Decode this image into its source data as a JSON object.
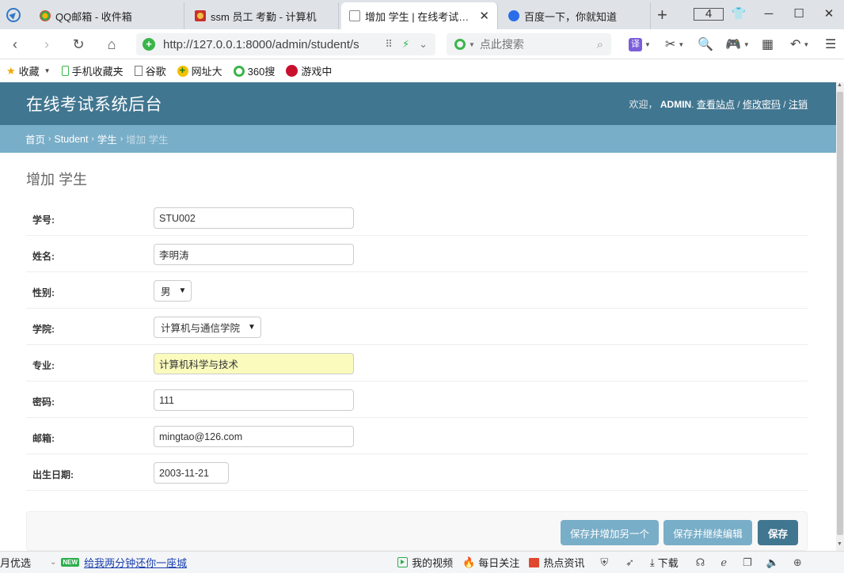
{
  "browser": {
    "tabs": [
      {
        "title": "QQ邮箱 - 收件箱",
        "active": false
      },
      {
        "title": "ssm 员工 考勤 - 计算机",
        "active": false
      },
      {
        "title": "增加 学生 | 在线考试系统",
        "active": true
      },
      {
        "title": "百度一下，你就知道",
        "active": false
      }
    ],
    "tab_count": "4",
    "url": "http://127.0.0.1:8000/admin/student/s",
    "search_placeholder": "点此搜索",
    "translate_label": "译",
    "bookmarks": [
      "收藏",
      "手机收藏夹",
      "谷歌",
      "网址大",
      "360搜",
      "游戏中"
    ]
  },
  "header": {
    "site_title": "在线考试系统后台",
    "welcome": "欢迎，",
    "username": "ADMIN",
    "view_site": "查看站点",
    "change_password": "修改密码",
    "logout": "注销",
    "sep": "/"
  },
  "breadcrumbs": {
    "home": "首页",
    "app": "Student",
    "model": "学生",
    "current": "增加 学生"
  },
  "page_title": "增加 学生",
  "form": {
    "student_id": {
      "label": "学号:",
      "value": "STU002"
    },
    "name": {
      "label": "姓名:",
      "value": "李明涛"
    },
    "gender": {
      "label": "性别:",
      "value": "男"
    },
    "college": {
      "label": "学院:",
      "value": "计算机与通信学院"
    },
    "major": {
      "label": "专业:",
      "value": "计算机科学与技术"
    },
    "password": {
      "label": "密码:",
      "value": "111"
    },
    "email": {
      "label": "邮箱:",
      "value": "mingtao@126.com"
    },
    "birthday": {
      "label": "出生日期:",
      "value": "2003-11-21"
    }
  },
  "buttons": {
    "save_add_another": "保存并增加另一个",
    "save_continue": "保存并继续编辑",
    "save": "保存"
  },
  "statusbar": {
    "left_cut": "月优选",
    "promo_tag": "NEW",
    "promo": "给我两分钟还你一座城",
    "my_video": "我的视频",
    "daily": "每日关注",
    "hot_news": "热点资讯",
    "download": "下载"
  }
}
